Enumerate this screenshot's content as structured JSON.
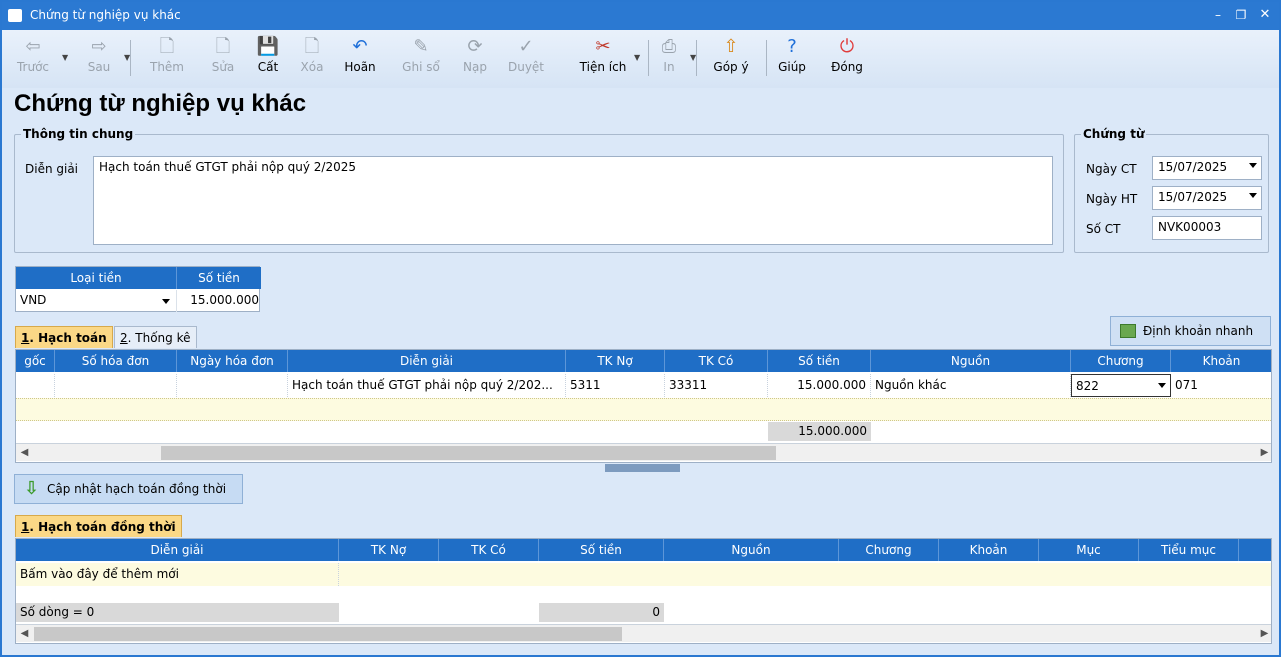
{
  "window": {
    "title": "Chứng từ nghiệp vụ khác"
  },
  "toolbar": {
    "items": [
      {
        "name": "prev",
        "label": "Trước",
        "icon": "arrow-left-icon",
        "glyph": "⇦",
        "enabled": false
      },
      {
        "name": "next",
        "label": "Sau",
        "icon": "arrow-right-icon",
        "glyph": "⇨",
        "enabled": false
      },
      {
        "name": "add",
        "label": "Thêm",
        "icon": "new-document-icon",
        "glyph": "🗋",
        "enabled": false
      },
      {
        "name": "edit",
        "label": "Sửa",
        "icon": "edit-document-icon",
        "glyph": "🗋",
        "enabled": false
      },
      {
        "name": "save",
        "label": "Cất",
        "icon": "floppy-disk-icon",
        "glyph": "💾",
        "enabled": true
      },
      {
        "name": "delete",
        "label": "Xóa",
        "icon": "delete-document-icon",
        "glyph": "🗋",
        "enabled": false
      },
      {
        "name": "undo",
        "label": "Hoãn",
        "icon": "undo-icon",
        "glyph": "↶",
        "enabled": true
      },
      {
        "name": "post",
        "label": "Ghi sổ",
        "icon": "pencil-icon",
        "glyph": "✎",
        "enabled": false
      },
      {
        "name": "reload",
        "label": "Nạp",
        "icon": "refresh-icon",
        "glyph": "⟳",
        "enabled": false
      },
      {
        "name": "approve",
        "label": "Duyệt",
        "icon": "checkmark-icon",
        "glyph": "✓",
        "enabled": false
      },
      {
        "name": "utilities",
        "label": "Tiện ích",
        "icon": "tools-icon",
        "glyph": "✂",
        "enabled": true
      },
      {
        "name": "print",
        "label": "In",
        "icon": "printer-icon",
        "glyph": "⎙",
        "enabled": false
      },
      {
        "name": "feedback",
        "label": "Góp ý",
        "icon": "feedback-icon",
        "glyph": "⇧",
        "enabled": true
      },
      {
        "name": "help",
        "label": "Giúp",
        "icon": "help-icon",
        "glyph": "?",
        "enabled": true
      },
      {
        "name": "close",
        "label": "Đóng",
        "icon": "power-icon",
        "glyph": "⏻",
        "enabled": true
      }
    ]
  },
  "page": {
    "title": "Chứng từ nghiệp vụ khác"
  },
  "general": {
    "legend": "Thông tin chung",
    "desc_label": "Diễn giải",
    "desc_value": "Hạch toán thuế GTGT phải nộp quý 2/2025"
  },
  "voucher": {
    "legend": "Chứng từ",
    "date_ct_label": "Ngày CT",
    "date_ct": "15/07/2025",
    "date_ht_label": "Ngày HT",
    "date_ht": "15/07/2025",
    "no_label": "Số CT",
    "no": "NVK00003"
  },
  "currency": {
    "type_header": "Loại tiền",
    "amount_header": "Số tiền",
    "type": "VND",
    "amount": "15.000.000"
  },
  "tabs": {
    "tab1_num": "1",
    "tab1": ". Hạch toán",
    "tab2_num": "2",
    "tab2": ". Thống kê"
  },
  "quick_entry": {
    "label": "Định khoản nhanh"
  },
  "grid1": {
    "headers": [
      "gốc",
      "Số hóa đơn",
      "Ngày hóa đơn",
      "Diễn giải",
      "TK Nợ",
      "TK Có",
      "Số tiền",
      "Nguồn",
      "Chương",
      "Khoản"
    ],
    "row": {
      "desc": "Hạch toán thuế GTGT phải nộp quý 2/202...",
      "debit": "5311",
      "credit": "33311",
      "amount": "15.000.000",
      "source": "Nguồn khác",
      "chapter": "822",
      "item": "071"
    },
    "total": "15.000.000"
  },
  "update_button": {
    "label": "Cập nhật hạch toán đồng thời"
  },
  "tabs2": {
    "tab1_num": "1",
    "tab1": ". Hạch toán đồng thời"
  },
  "grid2": {
    "headers": [
      "Diễn giải",
      "TK Nợ",
      "TK Có",
      "Số tiền",
      "Nguồn",
      "Chương",
      "Khoản",
      "Mục",
      "Tiểu mục"
    ],
    "add_row": "Bấm vào đây để thêm mới",
    "row_count": "Số dòng = 0",
    "total": "0"
  }
}
